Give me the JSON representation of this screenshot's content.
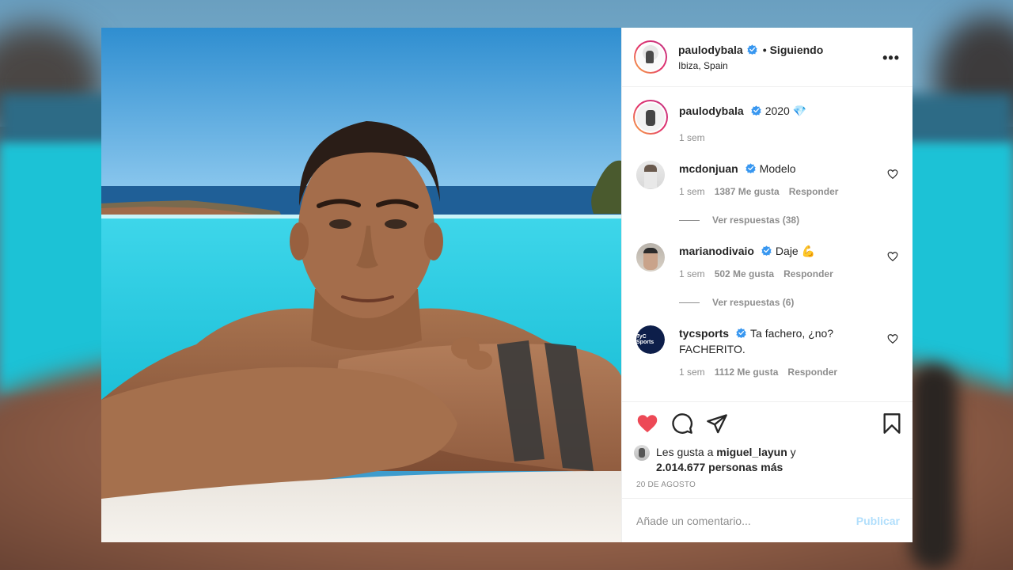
{
  "post": {
    "author": "paulodybala",
    "follow_status": "Siguiendo",
    "follow_dot": "•",
    "location": "Ibiza, Spain",
    "more_icon": "more-horizontal-icon",
    "caption": {
      "username": "paulodybala",
      "text": "2020 💎",
      "age": "1 sem"
    },
    "comments": [
      {
        "username": "mcdonjuan",
        "text": "Modelo",
        "age": "1 sem",
        "likes": "1387 Me gusta",
        "reply_label": "Responder",
        "view_replies": "Ver respuestas (38)"
      },
      {
        "username": "marianodivaio",
        "text": "Daje 💪",
        "age": "1 sem",
        "likes": "502 Me gusta",
        "reply_label": "Responder",
        "view_replies": "Ver respuestas (6)"
      },
      {
        "username": "tycsports",
        "text": "Ta fachero, ¿no? FACHERITO.",
        "age": "1 sem",
        "likes": "1112 Me gusta",
        "reply_label": "Responder",
        "avatar_text": "TyC Sports"
      }
    ],
    "likes_line": {
      "prefix": "Les gusta a",
      "user": "miguel_layun",
      "joiner": "y",
      "others": "2.014.677 personas más"
    },
    "date": "20 DE AGOSTO",
    "add_comment": {
      "placeholder": "Añade un comentario...",
      "publish_label": "Publicar"
    },
    "colors": {
      "liked_heart": "#ed4956",
      "verified": "#3897f0",
      "publish_disabled": "#b2dffc"
    }
  }
}
